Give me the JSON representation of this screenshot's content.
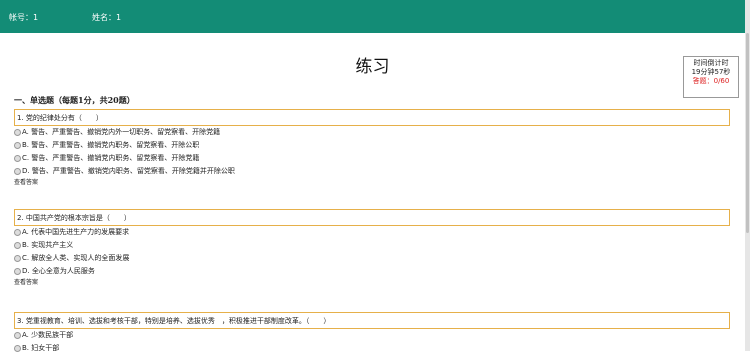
{
  "header": {
    "account_label": "帐号：1",
    "name_label": "姓名：1"
  },
  "page_title": "练习",
  "timer": {
    "line1": "时间倒计时",
    "line2": "19分钟57秒",
    "answered_label": "答题：",
    "answered_value": "0/60"
  },
  "section_title": "一、单选题（每题1分，共20题）",
  "view_answer_label": "查看答案",
  "questions": [
    {
      "text": "1. 党的纪律处分有（　　）",
      "options": [
        "A. 警告、严重警告、撤销党内外一切职务、留党察看、开除党籍",
        "B. 警告、严重警告、撤销党内职务、留党察看、开除公职",
        "C. 警告、严重警告、撤销党内职务、留党察看、开除党籍",
        "D. 警告、严重警告、撤销党内职务、留党察看、开除党籍并开除公职"
      ]
    },
    {
      "text": "2. 中国共产党的根本宗旨是（　　）",
      "options": [
        "A. 代表中国先进生产力的发展要求",
        "B. 实现共产主义",
        "C. 解放全人类、实现人的全面发展",
        "D. 全心全意为人民服务"
      ]
    },
    {
      "text": "3. 党重视教育、培训、选拔和考核干部，特别是培养、选拔优秀　，积极推进干部制度改革。（　　）",
      "options": [
        "A. 少数民族干部",
        "B. 妇女干部"
      ]
    }
  ]
}
